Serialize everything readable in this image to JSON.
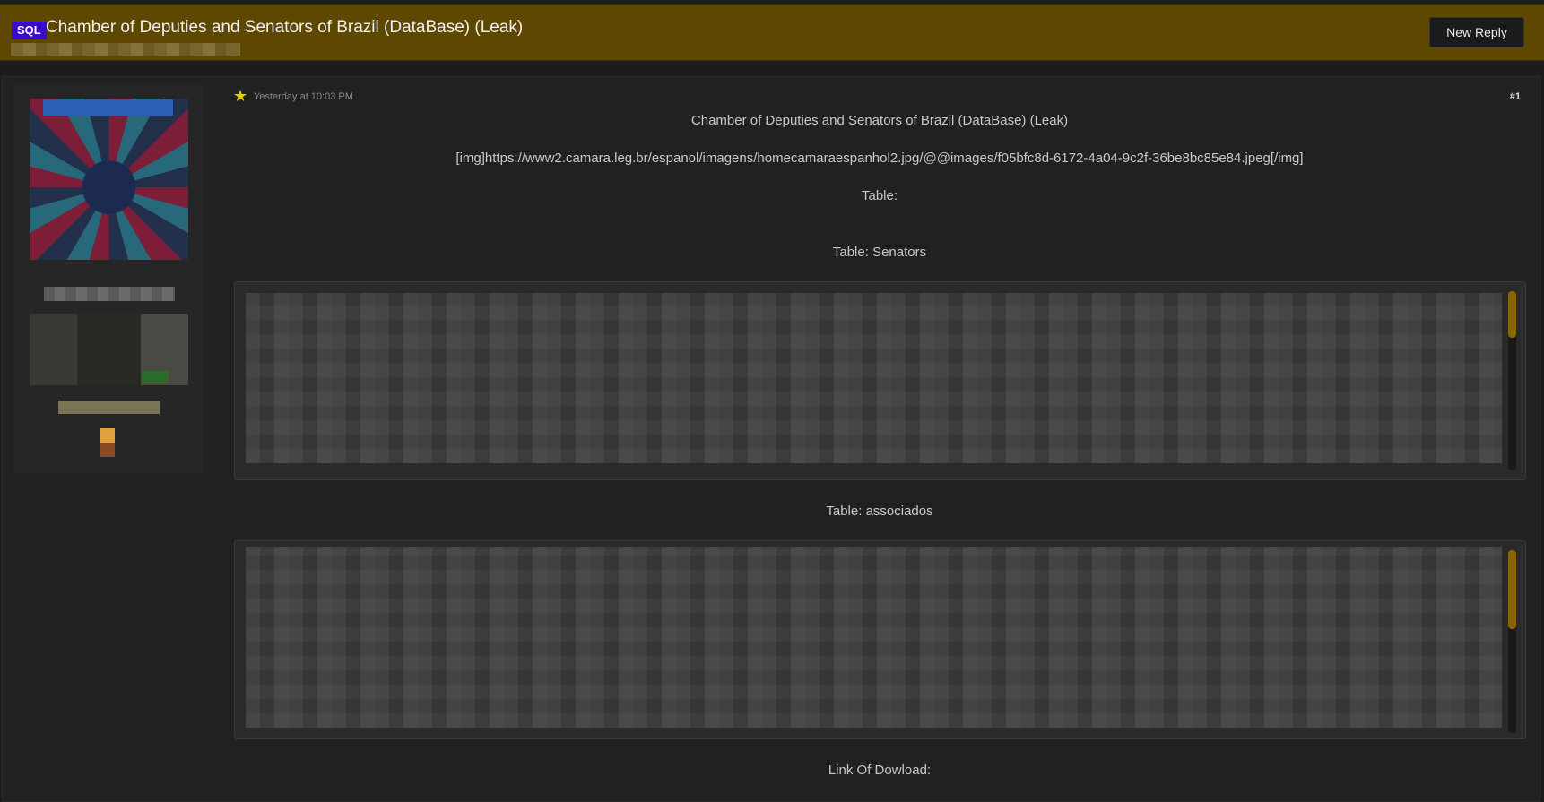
{
  "header": {
    "prefix_badge": "SQL",
    "title": "Chamber of Deputies and Senators of Brazil (DataBase) (Leak)",
    "new_reply_label": "New Reply"
  },
  "post": {
    "timestamp": "Yesterday at 10:03 PM",
    "post_number": "#1",
    "lines": {
      "title": "Chamber of Deputies and Senators of Brazil (DataBase) (Leak)",
      "img_url": "[img]https://www2.camara.leg.br/espanol/imagens/homecamaraespanhol2.jpg/@@images/f05bfc8d-6172-4a04-9c2f-36be8bc85e84.jpeg[/img]",
      "table_label": "Table:",
      "table_senators": "Table: Senators",
      "table_associados": "Table: associados",
      "download_link": "Link Of Dowload:"
    }
  },
  "colors": {
    "header_bg": "#5e4700",
    "badge_bg": "#3a0cc8",
    "scroll_thumb": "#8a6500",
    "star": "#e6d000"
  }
}
